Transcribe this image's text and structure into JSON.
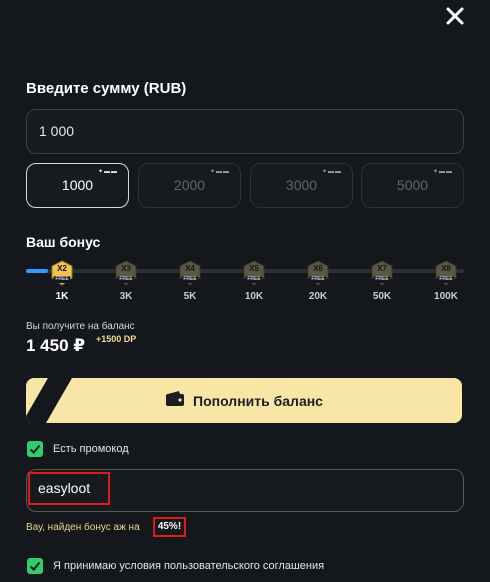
{
  "form": {
    "title": "Введите сумму (RUB)",
    "amount_value": "1 000"
  },
  "presets": [
    {
      "label": "1000",
      "active": true
    },
    {
      "label": "2000",
      "active": false
    },
    {
      "label": "3000",
      "active": false
    },
    {
      "label": "5000",
      "active": false
    }
  ],
  "bonus": {
    "title": "Ваш бонус",
    "progress": 0.03,
    "tiers": [
      {
        "mult": "X2",
        "label": "1K",
        "free": "FREE"
      },
      {
        "mult": "X3",
        "label": "3K",
        "free": "FREE"
      },
      {
        "mult": "X4",
        "label": "5K",
        "free": "FREE"
      },
      {
        "mult": "X5",
        "label": "10K",
        "free": "FREE"
      },
      {
        "mult": "X6",
        "label": "20K",
        "free": "FREE"
      },
      {
        "mult": "X7",
        "label": "50K",
        "free": "FREE"
      },
      {
        "mult": "X8",
        "label": "100K",
        "free": "FREE"
      }
    ]
  },
  "receive": {
    "label": "Вы получите на баланс",
    "amount": "1 450 ₽",
    "dp": "+1500 DP"
  },
  "deposit_button": {
    "label": "Пополнить баланс",
    "icon": "wallet-icon"
  },
  "promo": {
    "checkbox_label": "Есть промокод",
    "checked": true,
    "code": "easyloot",
    "message": "Вау, найден бонус аж на",
    "percent": "45%!"
  },
  "terms": {
    "label": "Я принимаю условия пользовательского соглашения",
    "checked": true
  },
  "colors": {
    "background": "#14171c",
    "accent_yellow": "#f7e6a6",
    "checkbox_green": "#2ccf6c",
    "progress_blue": "#2f9bff",
    "highlight_red": "#e11a1a"
  }
}
